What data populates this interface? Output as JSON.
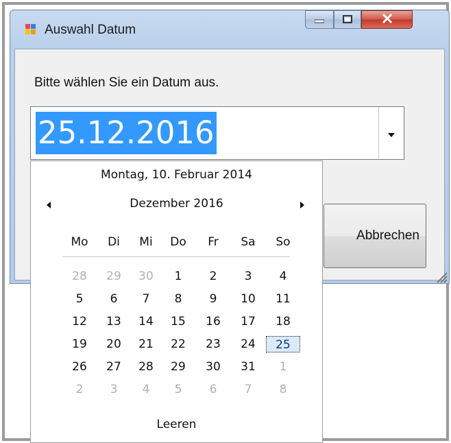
{
  "window": {
    "title": "Auswahl Datum",
    "prompt": "Bitte wählen Sie ein Datum aus.",
    "date_value": "25.12.2016",
    "cancel_label": "Abbrechen"
  },
  "calendar": {
    "today_text": "Montag, 10. Februar 2014",
    "month_label": "Dezember 2016",
    "weekdays": [
      "Mo",
      "Di",
      "Mi",
      "Do",
      "Fr",
      "Sa",
      "So"
    ],
    "weeks": [
      [
        "28",
        "29",
        "30",
        "1",
        "2",
        "3",
        "4"
      ],
      [
        "5",
        "6",
        "7",
        "8",
        "9",
        "10",
        "11"
      ],
      [
        "12",
        "13",
        "14",
        "15",
        "16",
        "17",
        "18"
      ],
      [
        "19",
        "20",
        "21",
        "22",
        "23",
        "24",
        "25"
      ],
      [
        "26",
        "27",
        "28",
        "29",
        "30",
        "31",
        "1"
      ],
      [
        "2",
        "3",
        "4",
        "5",
        "6",
        "7",
        "8"
      ]
    ],
    "selected_day": "25",
    "clear_label": "Leeren"
  },
  "colors": {
    "selection_blue": "#3399ff",
    "close_red": "#c4392b",
    "title_bar": "#c7daf0"
  },
  "icons": [
    "app-icon",
    "minimize-icon",
    "maximize-icon",
    "close-icon",
    "chevron-down-icon",
    "arrow-left-icon",
    "arrow-right-icon",
    "resize-grip-icon"
  ]
}
